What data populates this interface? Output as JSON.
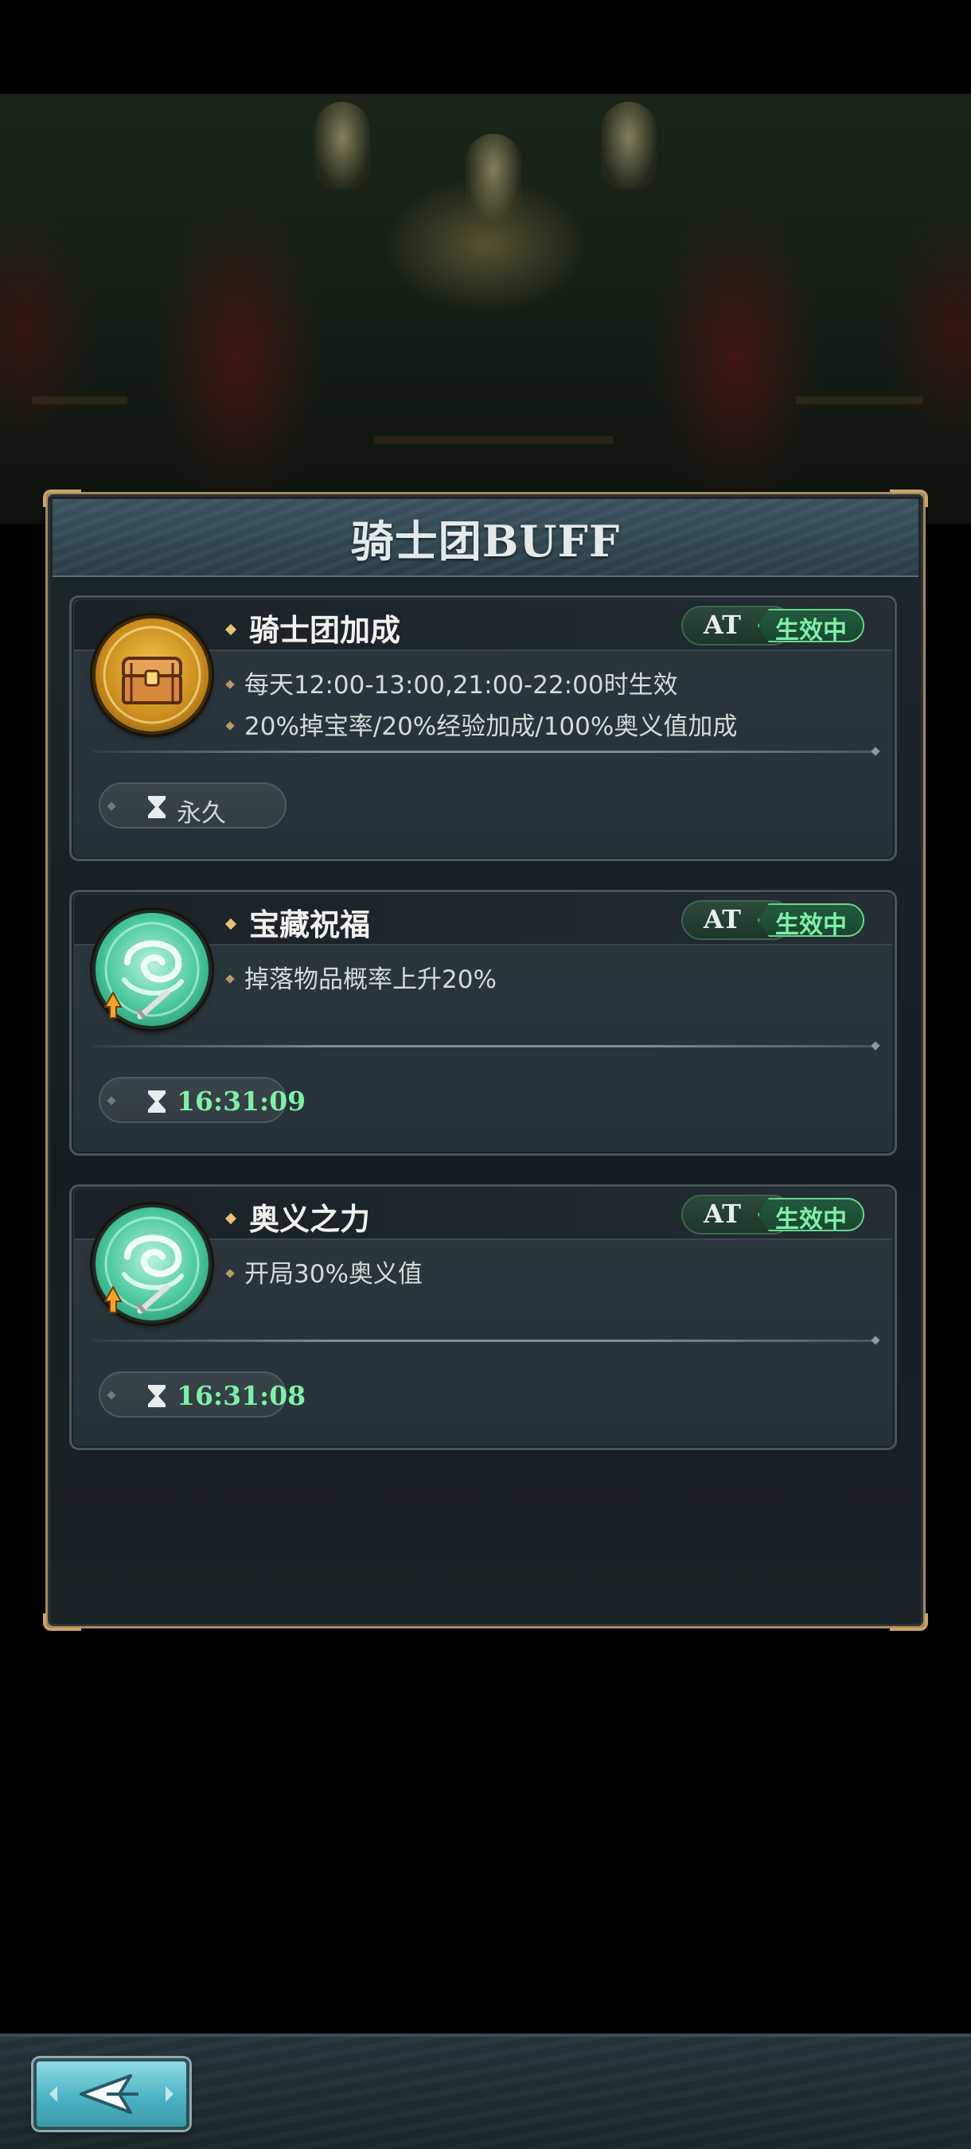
{
  "panel": {
    "title": "骑士团BUFF"
  },
  "buffs": [
    {
      "name": "骑士团加成",
      "icon": "treasure-chest-icon",
      "status_tag": "AT",
      "status": "生效中",
      "descriptions": [
        "每天12:00-13:00,21:00-22:00时生效",
        "20%掉宝率/20%经验加成/100%奥义值加成"
      ],
      "duration": "永久"
    },
    {
      "name": "宝藏祝福",
      "icon": "green-swirl-buff-icon",
      "status_tag": "AT",
      "status": "生效中",
      "descriptions": [
        "掉落物品概率上升20%"
      ],
      "duration": "16:31:09"
    },
    {
      "name": "奥义之力",
      "icon": "green-swirl-buff-icon",
      "status_tag": "AT",
      "status": "生效中",
      "descriptions": [
        "开局30%奥义值"
      ],
      "duration": "16:31:08"
    }
  ],
  "colors": {
    "active_green": "#7ff0a6",
    "frame_gold": "#a8885a",
    "back_button": "#4cb3c4"
  },
  "nav": {
    "back_icon": "back-arrow-icon"
  }
}
